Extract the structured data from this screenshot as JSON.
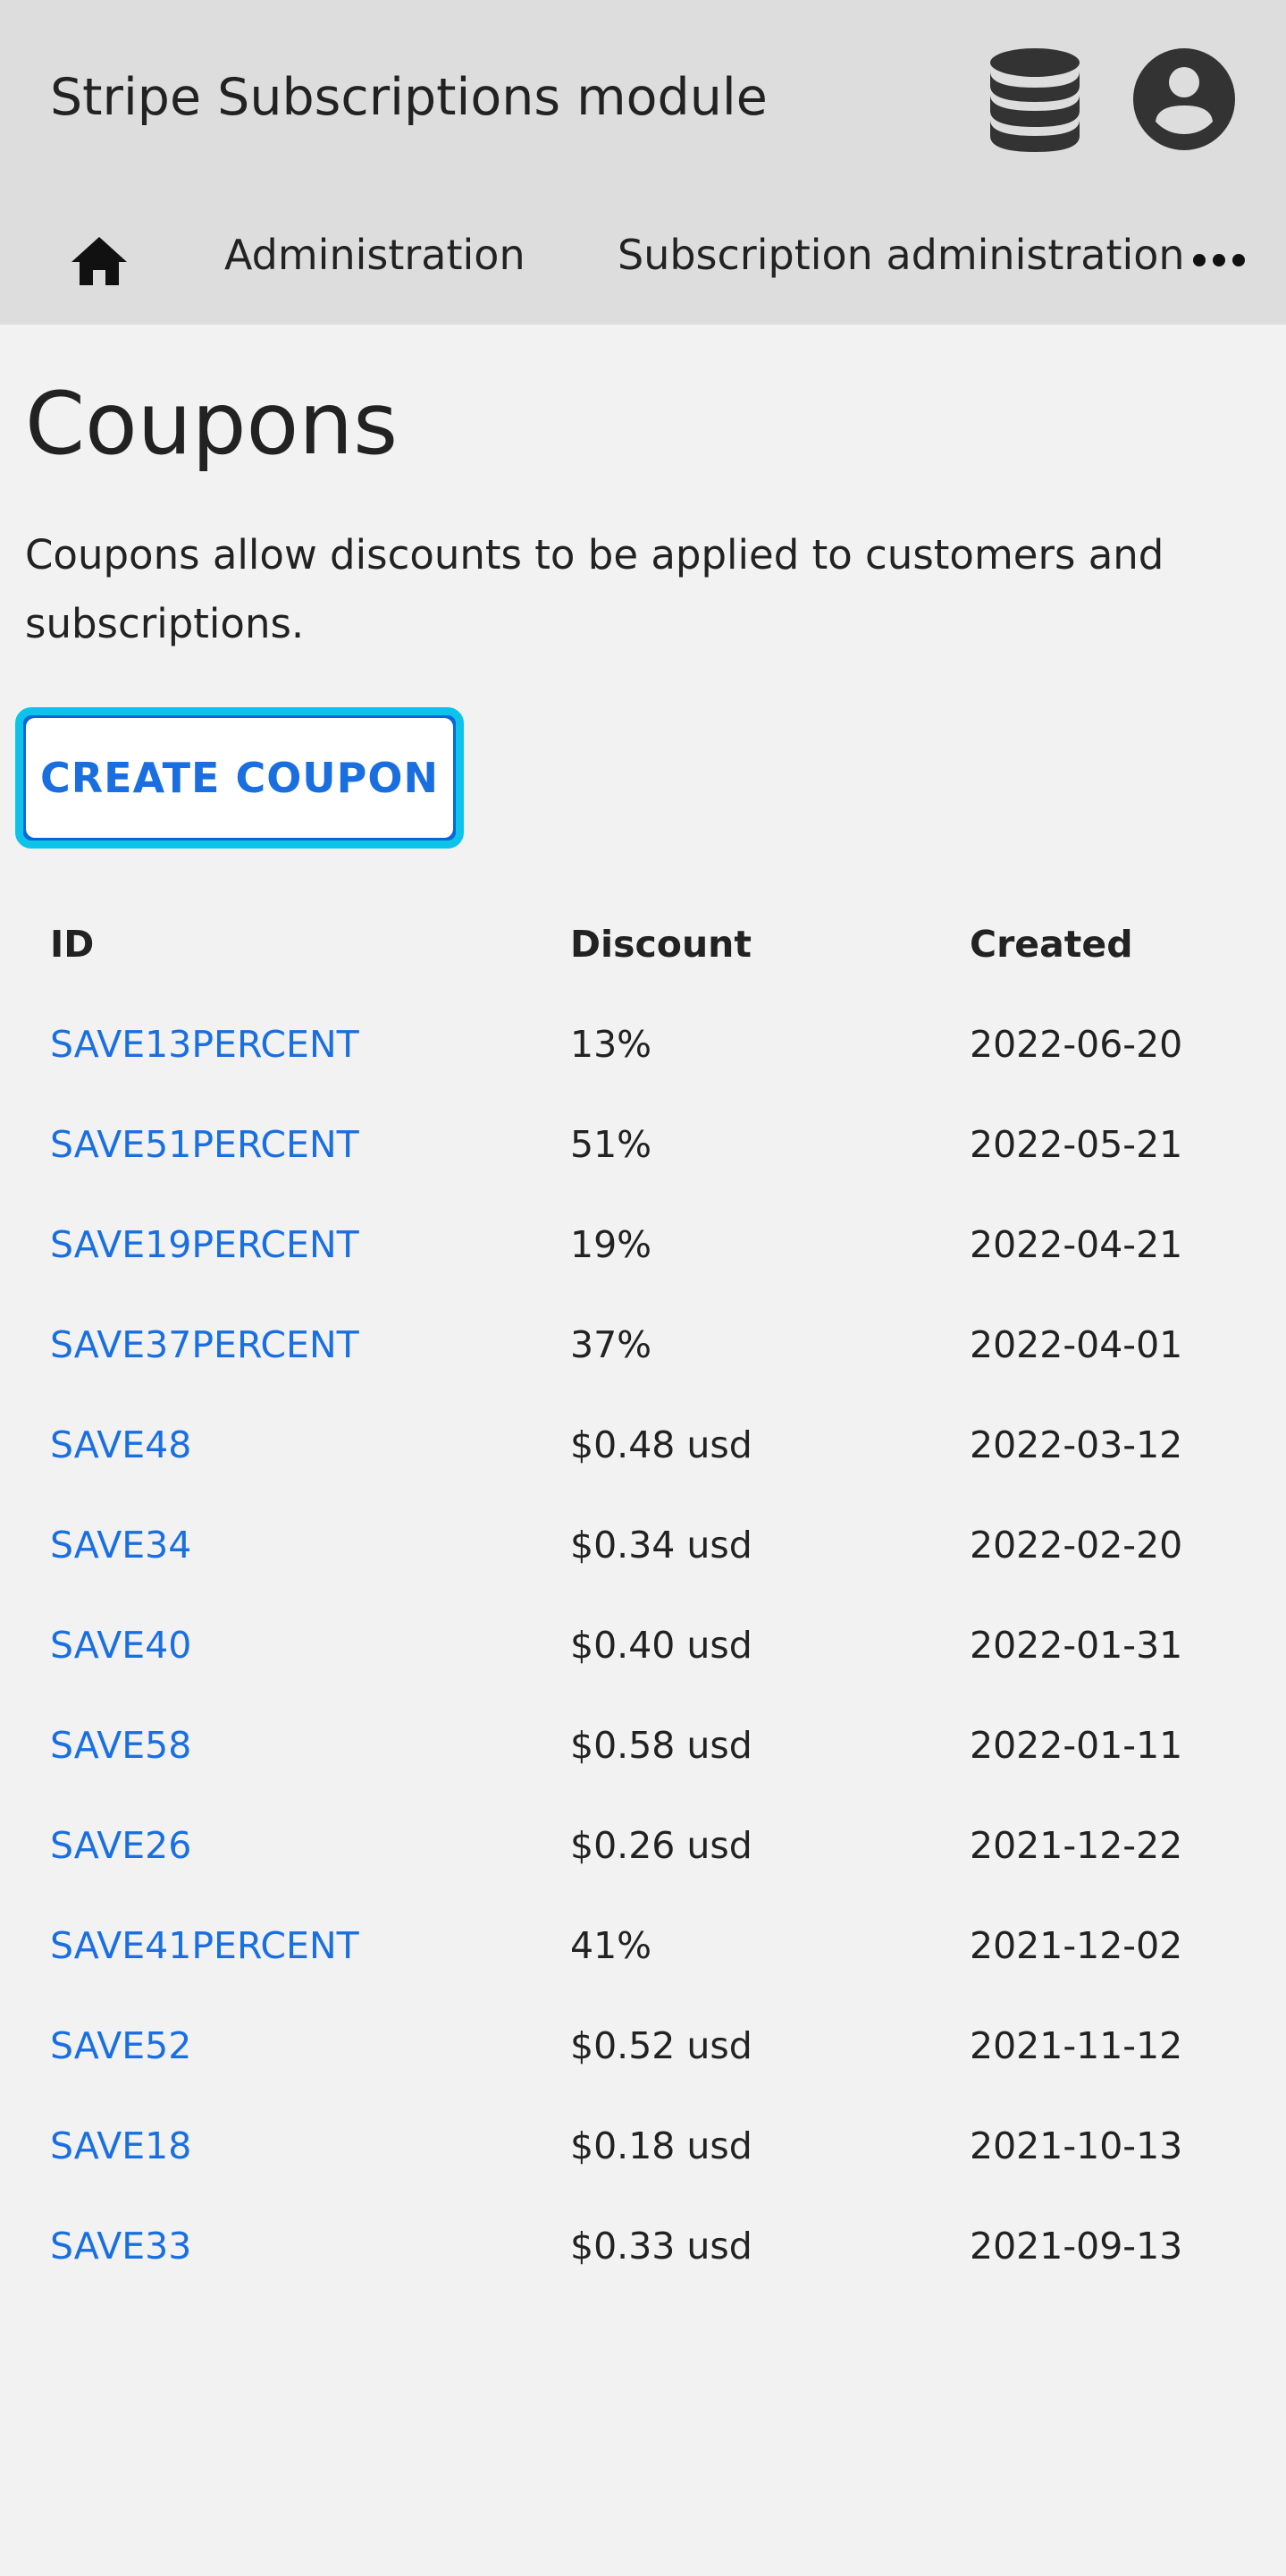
{
  "header": {
    "title": "Stripe Subscriptions module",
    "icons": [
      "database-icon",
      "account-icon"
    ]
  },
  "nav": {
    "home_icon": "home-icon",
    "items": [
      {
        "label": "Administration"
      },
      {
        "label": "Subscription administration"
      }
    ],
    "more_icon": "more-horizontal-icon"
  },
  "main": {
    "title": "Coupons",
    "description": "Coupons allow discounts to be applied to customers and subscriptions.",
    "create_button": "CREATE COUPON"
  },
  "table": {
    "columns": [
      "ID",
      "Discount",
      "Created"
    ],
    "rows": [
      {
        "id": "SAVE13PERCENT",
        "discount": "13%",
        "created": "2022-06-20"
      },
      {
        "id": "SAVE51PERCENT",
        "discount": "51%",
        "created": "2022-05-21"
      },
      {
        "id": "SAVE19PERCENT",
        "discount": "19%",
        "created": "2022-04-21"
      },
      {
        "id": "SAVE37PERCENT",
        "discount": "37%",
        "created": "2022-04-01"
      },
      {
        "id": "SAVE48",
        "discount": "$0.48 usd",
        "created": "2022-03-12"
      },
      {
        "id": "SAVE34",
        "discount": "$0.34 usd",
        "created": "2022-02-20"
      },
      {
        "id": "SAVE40",
        "discount": "$0.40 usd",
        "created": "2022-01-31"
      },
      {
        "id": "SAVE58",
        "discount": "$0.58 usd",
        "created": "2022-01-11"
      },
      {
        "id": "SAVE26",
        "discount": "$0.26 usd",
        "created": "2021-12-22"
      },
      {
        "id": "SAVE41PERCENT",
        "discount": "41%",
        "created": "2021-12-02"
      },
      {
        "id": "SAVE52",
        "discount": "$0.52 usd",
        "created": "2021-11-12"
      },
      {
        "id": "SAVE18",
        "discount": "$0.18 usd",
        "created": "2021-10-13"
      },
      {
        "id": "SAVE33",
        "discount": "$0.33 usd",
        "created": "2021-09-13"
      }
    ]
  },
  "colors": {
    "header_bg": "#dddddd",
    "page_bg": "#f2f2f2",
    "link": "#1a6fe0",
    "focus_ring": "#0cc3ea",
    "text": "#222222"
  }
}
